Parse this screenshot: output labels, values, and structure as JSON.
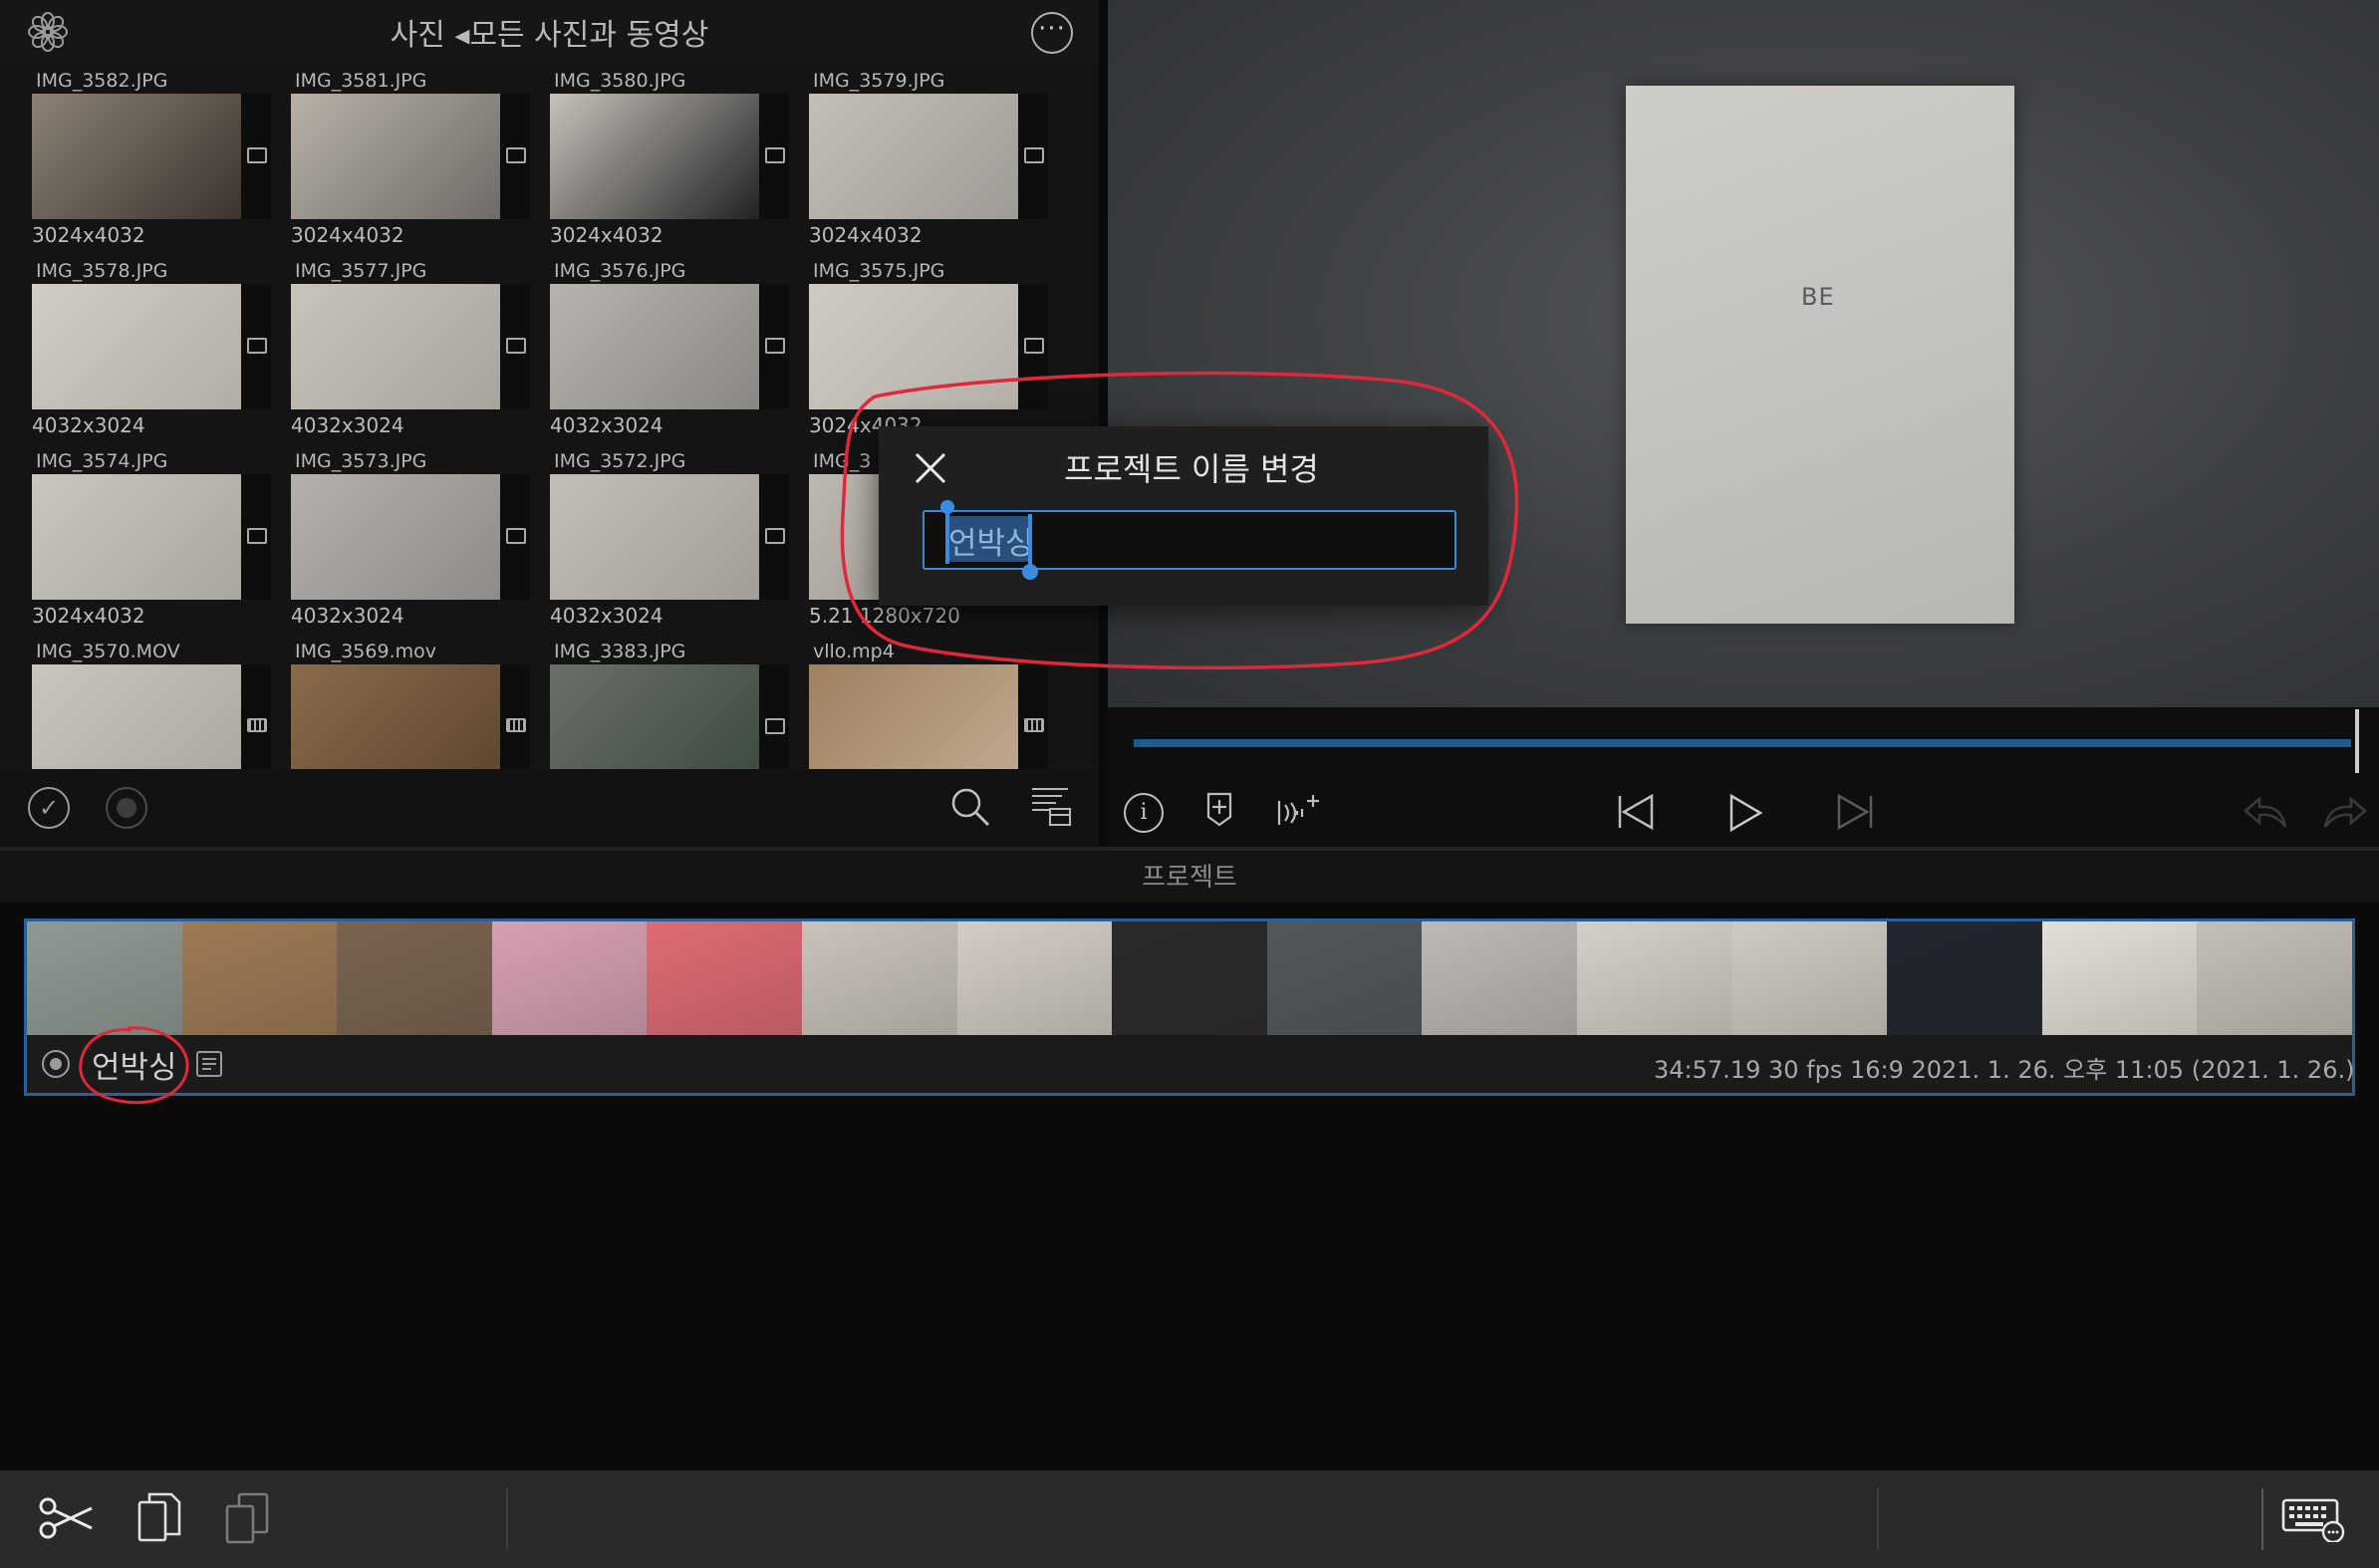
{
  "browser": {
    "title": "사진 ◂모든 사진과 동영상",
    "items": [
      {
        "name": "IMG_3582.JPG",
        "size": "3024x4032",
        "type": "photo",
        "c1": "#8c8274",
        "c2": "#3a342e"
      },
      {
        "name": "IMG_3581.JPG",
        "size": "3024x4032",
        "type": "photo",
        "c1": "#b8b2a8",
        "c2": "#6e6a66"
      },
      {
        "name": "IMG_3580.JPG",
        "size": "3024x4032",
        "type": "photo",
        "c1": "#c7c2bb",
        "c2": "#222"
      },
      {
        "name": "IMG_3579.JPG",
        "size": "3024x4032",
        "type": "photo",
        "c1": "#c4bfb8",
        "c2": "#9e9a95"
      },
      {
        "name": "IMG_3578.JPG",
        "size": "4032x3024",
        "type": "photo",
        "c1": "#d1ccc5",
        "c2": "#b2ada6"
      },
      {
        "name": "IMG_3577.JPG",
        "size": "4032x3024",
        "type": "photo",
        "c1": "#c8c3bc",
        "c2": "#a8a39c"
      },
      {
        "name": "IMG_3576.JPG",
        "size": "4032x3024",
        "type": "photo",
        "c1": "#b7b3ae",
        "c2": "#8a8783"
      },
      {
        "name": "IMG_3575.JPG",
        "size": "3024x4032",
        "type": "photo",
        "c1": "#cfcac3",
        "c2": "#b5b0a9"
      },
      {
        "name": "IMG_3574.JPG",
        "size": "3024x4032",
        "type": "photo",
        "c1": "#c9c5bf",
        "c2": "#a9a59f"
      },
      {
        "name": "IMG_3573.JPG",
        "size": "4032x3024",
        "type": "photo",
        "c1": "#b4b1ad",
        "c2": "#8e8b87"
      },
      {
        "name": "IMG_3572.JPG",
        "size": "4032x3024",
        "type": "photo",
        "c1": "#c3beb7",
        "c2": "#a29d96"
      },
      {
        "name": "IMG_3",
        "size": "5.21 1280x720",
        "type": "video",
        "c1": "#bdb8b1",
        "c2": "#9a958e"
      },
      {
        "name": "IMG_3570.MOV",
        "size": "",
        "type": "video",
        "c1": "#c8c4be",
        "c2": "#aaa6a0"
      },
      {
        "name": "IMG_3569.mov",
        "size": "",
        "type": "video",
        "c1": "#8a6a4a",
        "c2": "#5e4530"
      },
      {
        "name": "IMG_3383.JPG",
        "size": "",
        "type": "photo",
        "c1": "#6b6f6a",
        "c2": "#3b4a3e"
      },
      {
        "name": "vllo.mp4",
        "size": "",
        "type": "video",
        "c1": "#9f8060",
        "c2": "#c0ab90"
      }
    ]
  },
  "dialog": {
    "title": "프로젝트 이름 변경",
    "input_value": "언박싱"
  },
  "project": {
    "section_label": "프로젝트",
    "name": "언박싱",
    "meta": "34:57.19  30 fps  16:9  2021. 1. 26. 오후 11:05  (2021. 1. 26.)",
    "preview_label": "BE"
  },
  "colors": {
    "accent": "#3e86d6",
    "annotation": "#e0283c",
    "selection_border": "#2b5f99"
  },
  "icons": [
    "flower-icon",
    "more-icon",
    "close-icon",
    "checkmark-icon",
    "record-icon",
    "search-icon",
    "sort-icon",
    "info-icon",
    "marker-icon",
    "audio-icon",
    "skip-back-icon",
    "play-icon",
    "skip-forward-icon",
    "undo-icon",
    "redo-icon",
    "note-icon",
    "scissors-icon",
    "copy-icon",
    "paste-icon",
    "keyboard-icon"
  ]
}
